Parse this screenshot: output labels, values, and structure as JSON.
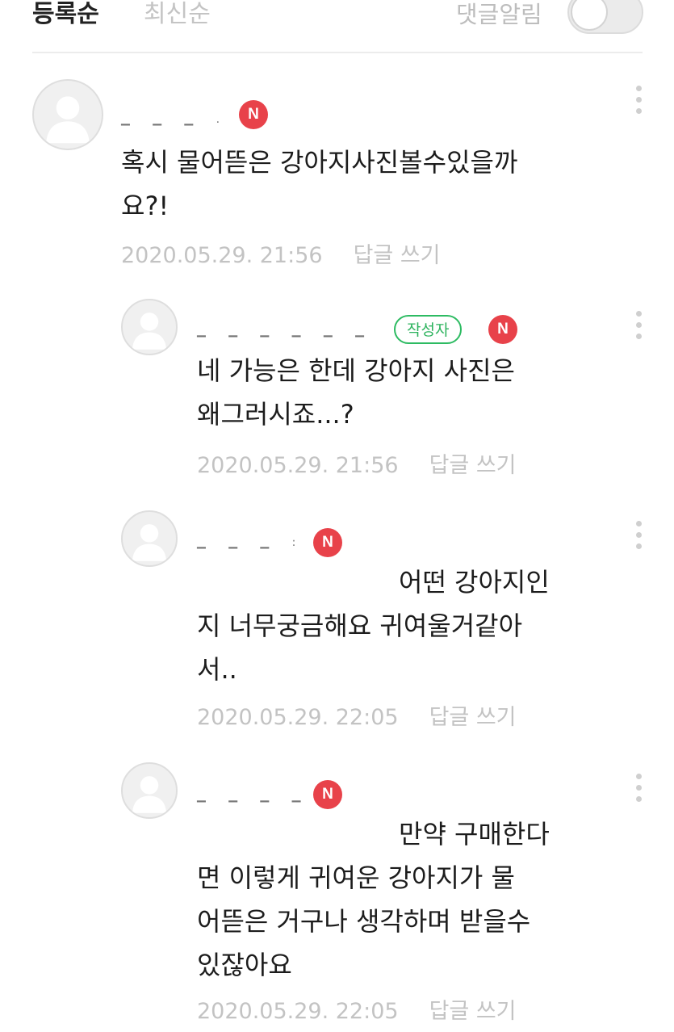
{
  "sort_tabs": {
    "active": "등록순",
    "inactive": "최신순"
  },
  "notification": {
    "label": "댓글알림",
    "enabled": false
  },
  "colors": {
    "new_badge": "#e8424a",
    "author_tag": "#2dbb62",
    "meta_text": "#c3c3c3"
  },
  "comments": [
    {
      "badge": "N",
      "lines": [
        "혹시 물어뜯은 강아지사진볼수있을까",
        "요?!"
      ],
      "timestamp": "2020.05.29. 21:56",
      "reply_label": "답글 쓰기"
    },
    {
      "badge": "N",
      "author_tag": "작성자",
      "lines": [
        "네 가능은 한데 강아지 사진은",
        "왜그러시죠...?"
      ],
      "timestamp": "2020.05.29. 21:56",
      "reply_label": "답글 쓰기"
    },
    {
      "badge": "N",
      "lines": [
        "어떤 강아지인",
        "지 너무궁금해요 귀여울거같아",
        "서.."
      ],
      "timestamp": "2020.05.29. 22:05",
      "reply_label": "답글 쓰기"
    },
    {
      "badge": "N",
      "lines": [
        "만약 구매한다",
        "면 이렇게 귀여운 강아지가 물",
        "어뜯은 거구나 생각하며 받을수",
        "있잖아요"
      ],
      "timestamp": "2020.05.29. 22:05",
      "reply_label": "답글 쓰기"
    }
  ]
}
